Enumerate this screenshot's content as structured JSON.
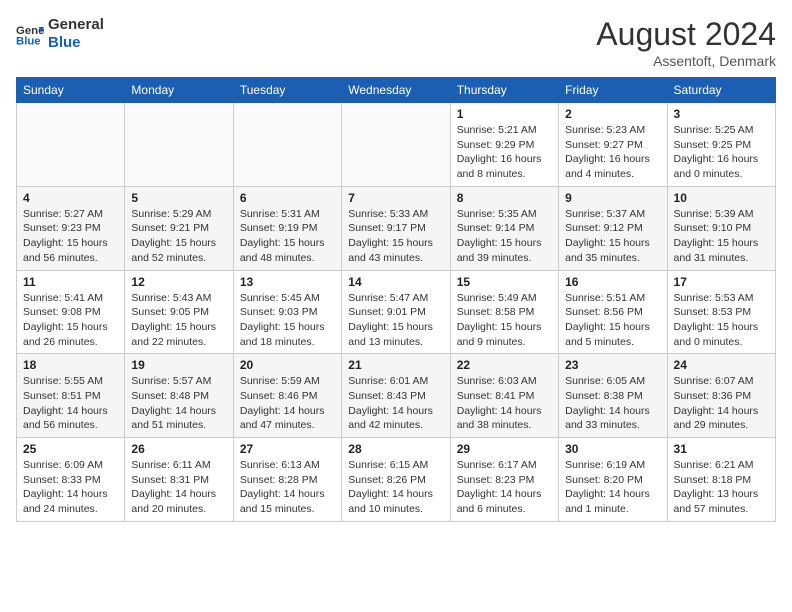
{
  "header": {
    "logo_line1": "General",
    "logo_line2": "Blue",
    "month_year": "August 2024",
    "location": "Assentoft, Denmark"
  },
  "days_of_week": [
    "Sunday",
    "Monday",
    "Tuesday",
    "Wednesday",
    "Thursday",
    "Friday",
    "Saturday"
  ],
  "weeks": [
    [
      {
        "day": "",
        "info": ""
      },
      {
        "day": "",
        "info": ""
      },
      {
        "day": "",
        "info": ""
      },
      {
        "day": "",
        "info": ""
      },
      {
        "day": "1",
        "info": "Sunrise: 5:21 AM\nSunset: 9:29 PM\nDaylight: 16 hours\nand 8 minutes."
      },
      {
        "day": "2",
        "info": "Sunrise: 5:23 AM\nSunset: 9:27 PM\nDaylight: 16 hours\nand 4 minutes."
      },
      {
        "day": "3",
        "info": "Sunrise: 5:25 AM\nSunset: 9:25 PM\nDaylight: 16 hours\nand 0 minutes."
      }
    ],
    [
      {
        "day": "4",
        "info": "Sunrise: 5:27 AM\nSunset: 9:23 PM\nDaylight: 15 hours\nand 56 minutes."
      },
      {
        "day": "5",
        "info": "Sunrise: 5:29 AM\nSunset: 9:21 PM\nDaylight: 15 hours\nand 52 minutes."
      },
      {
        "day": "6",
        "info": "Sunrise: 5:31 AM\nSunset: 9:19 PM\nDaylight: 15 hours\nand 48 minutes."
      },
      {
        "day": "7",
        "info": "Sunrise: 5:33 AM\nSunset: 9:17 PM\nDaylight: 15 hours\nand 43 minutes."
      },
      {
        "day": "8",
        "info": "Sunrise: 5:35 AM\nSunset: 9:14 PM\nDaylight: 15 hours\nand 39 minutes."
      },
      {
        "day": "9",
        "info": "Sunrise: 5:37 AM\nSunset: 9:12 PM\nDaylight: 15 hours\nand 35 minutes."
      },
      {
        "day": "10",
        "info": "Sunrise: 5:39 AM\nSunset: 9:10 PM\nDaylight: 15 hours\nand 31 minutes."
      }
    ],
    [
      {
        "day": "11",
        "info": "Sunrise: 5:41 AM\nSunset: 9:08 PM\nDaylight: 15 hours\nand 26 minutes."
      },
      {
        "day": "12",
        "info": "Sunrise: 5:43 AM\nSunset: 9:05 PM\nDaylight: 15 hours\nand 22 minutes."
      },
      {
        "day": "13",
        "info": "Sunrise: 5:45 AM\nSunset: 9:03 PM\nDaylight: 15 hours\nand 18 minutes."
      },
      {
        "day": "14",
        "info": "Sunrise: 5:47 AM\nSunset: 9:01 PM\nDaylight: 15 hours\nand 13 minutes."
      },
      {
        "day": "15",
        "info": "Sunrise: 5:49 AM\nSunset: 8:58 PM\nDaylight: 15 hours\nand 9 minutes."
      },
      {
        "day": "16",
        "info": "Sunrise: 5:51 AM\nSunset: 8:56 PM\nDaylight: 15 hours\nand 5 minutes."
      },
      {
        "day": "17",
        "info": "Sunrise: 5:53 AM\nSunset: 8:53 PM\nDaylight: 15 hours\nand 0 minutes."
      }
    ],
    [
      {
        "day": "18",
        "info": "Sunrise: 5:55 AM\nSunset: 8:51 PM\nDaylight: 14 hours\nand 56 minutes."
      },
      {
        "day": "19",
        "info": "Sunrise: 5:57 AM\nSunset: 8:48 PM\nDaylight: 14 hours\nand 51 minutes."
      },
      {
        "day": "20",
        "info": "Sunrise: 5:59 AM\nSunset: 8:46 PM\nDaylight: 14 hours\nand 47 minutes."
      },
      {
        "day": "21",
        "info": "Sunrise: 6:01 AM\nSunset: 8:43 PM\nDaylight: 14 hours\nand 42 minutes."
      },
      {
        "day": "22",
        "info": "Sunrise: 6:03 AM\nSunset: 8:41 PM\nDaylight: 14 hours\nand 38 minutes."
      },
      {
        "day": "23",
        "info": "Sunrise: 6:05 AM\nSunset: 8:38 PM\nDaylight: 14 hours\nand 33 minutes."
      },
      {
        "day": "24",
        "info": "Sunrise: 6:07 AM\nSunset: 8:36 PM\nDaylight: 14 hours\nand 29 minutes."
      }
    ],
    [
      {
        "day": "25",
        "info": "Sunrise: 6:09 AM\nSunset: 8:33 PM\nDaylight: 14 hours\nand 24 minutes."
      },
      {
        "day": "26",
        "info": "Sunrise: 6:11 AM\nSunset: 8:31 PM\nDaylight: 14 hours\nand 20 minutes."
      },
      {
        "day": "27",
        "info": "Sunrise: 6:13 AM\nSunset: 8:28 PM\nDaylight: 14 hours\nand 15 minutes."
      },
      {
        "day": "28",
        "info": "Sunrise: 6:15 AM\nSunset: 8:26 PM\nDaylight: 14 hours\nand 10 minutes."
      },
      {
        "day": "29",
        "info": "Sunrise: 6:17 AM\nSunset: 8:23 PM\nDaylight: 14 hours\nand 6 minutes."
      },
      {
        "day": "30",
        "info": "Sunrise: 6:19 AM\nSunset: 8:20 PM\nDaylight: 14 hours\nand 1 minute."
      },
      {
        "day": "31",
        "info": "Sunrise: 6:21 AM\nSunset: 8:18 PM\nDaylight: 13 hours\nand 57 minutes."
      }
    ]
  ]
}
